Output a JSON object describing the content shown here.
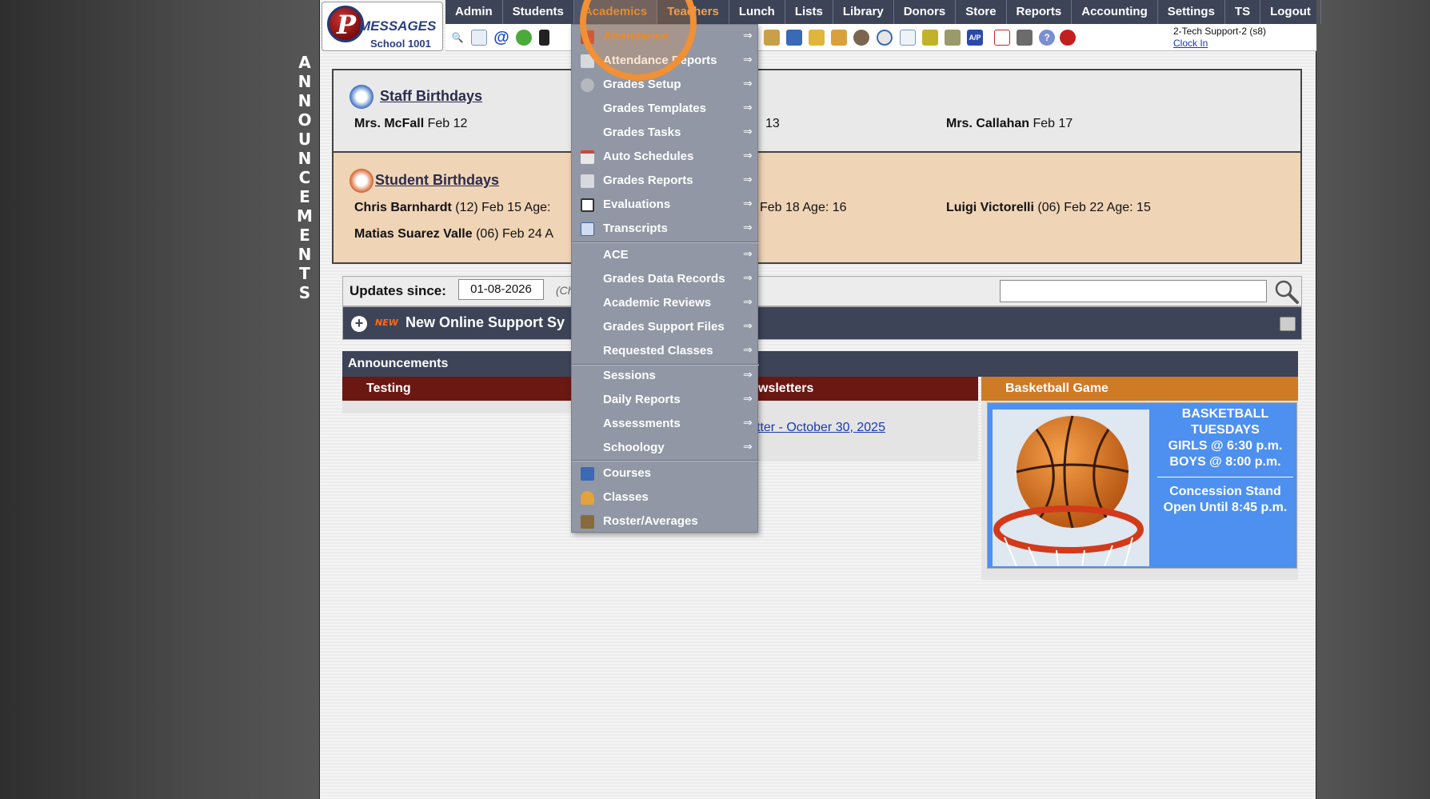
{
  "side_banner": [
    "A",
    "N",
    "N",
    "O",
    "U",
    "N",
    "C",
    "E",
    "M",
    "E",
    "N",
    "T",
    "S"
  ],
  "logo": {
    "letter": "P",
    "text": "MESSAGES",
    "school": "School 1001"
  },
  "nav": [
    {
      "label": "Admin"
    },
    {
      "label": "Students"
    },
    {
      "label": "Academics"
    },
    {
      "label": "Teachers"
    },
    {
      "label": "Lunch"
    },
    {
      "label": "Lists"
    },
    {
      "label": "Library"
    },
    {
      "label": "Donors"
    },
    {
      "label": "Store"
    },
    {
      "label": "Reports"
    },
    {
      "label": "Accounting"
    },
    {
      "label": "Settings"
    },
    {
      "label": "TS"
    },
    {
      "label": "Logout"
    }
  ],
  "user": {
    "name": "2-Tech Support-2 (s8)",
    "clock": "Clock In"
  },
  "staff_birthdays": {
    "title": "Staff Birthdays",
    "entries": [
      {
        "name": "Mrs. McFall",
        "date": "Feb 12"
      },
      {
        "name": "",
        "date": "13"
      },
      {
        "name": "Mrs. Callahan",
        "date": "Feb 17"
      }
    ]
  },
  "student_birthdays": {
    "title": " Student Birthdays",
    "entries": [
      {
        "name": "Chris Barnhardt",
        "rest": "(12) Feb 15 Age:"
      },
      {
        "name": "",
        "rest": "Feb 18 Age: 16"
      },
      {
        "name": "Luigi Victorelli",
        "rest": "(06) Feb 22 Age: 15"
      },
      {
        "name": "Matias Suarez Valle",
        "rest": "(06) Feb 24 A"
      }
    ]
  },
  "updates": {
    "label": "Updates since:",
    "date": "01-08-2026",
    "hint": "(Ch"
  },
  "support": {
    "badge": "NEW",
    "text": "New Online Support Sy"
  },
  "announcements": {
    "header": "Announcements",
    "columns": [
      {
        "title": "Testing"
      },
      {
        "title": "wsletters"
      },
      {
        "title": "Basketball Game"
      }
    ],
    "newsletter_link": "tter - October 30, 2025"
  },
  "basketball": {
    "line1": "BASKETBALL",
    "line2": "TUESDAYS",
    "line3": "GIRLS @ 6:30 p.m.",
    "line4": "BOYS  @ 8:00 p.m.",
    "line5": "Concession Stand",
    "line6": "Open Until 8:45 p.m."
  },
  "academics_menu": [
    {
      "label": "Attendance",
      "icon": "calendar-icon"
    },
    {
      "label": "Attendance Reports",
      "icon": "printer-icon"
    },
    {
      "label": "Grades Setup",
      "icon": "gear-icon"
    },
    {
      "label": "Grades Templates",
      "icon": ""
    },
    {
      "label": "Grades Tasks",
      "icon": ""
    },
    {
      "label": "Auto Schedules",
      "icon": "calendar-clock-icon"
    },
    {
      "label": "Grades Reports",
      "icon": "printer-icon"
    },
    {
      "label": "Evaluations",
      "icon": "checkbox-icon"
    },
    {
      "label": "Transcripts",
      "icon": "document-icon"
    },
    {
      "label": "ACE",
      "icon": ""
    },
    {
      "label": "Grades Data Records",
      "icon": ""
    },
    {
      "label": "Academic Reviews",
      "icon": ""
    },
    {
      "label": "Grades Support Files",
      "icon": ""
    },
    {
      "label": "Requested Classes",
      "icon": ""
    },
    {
      "label": "Sessions",
      "icon": ""
    },
    {
      "label": "Daily Reports",
      "icon": ""
    },
    {
      "label": "Assessments",
      "icon": ""
    },
    {
      "label": "Schoology",
      "icon": ""
    },
    {
      "label": "Courses",
      "icon": "book-icon"
    },
    {
      "label": "Classes",
      "icon": "person-icon"
    },
    {
      "label": "Roster/Averages",
      "icon": "roster-icon"
    }
  ],
  "menu_arrow": "⇒",
  "colors": {
    "nav_bg": "#3d4458",
    "accent": "#e58a2a",
    "menu_bg": "#9197a4",
    "highlight": "#f19035"
  }
}
